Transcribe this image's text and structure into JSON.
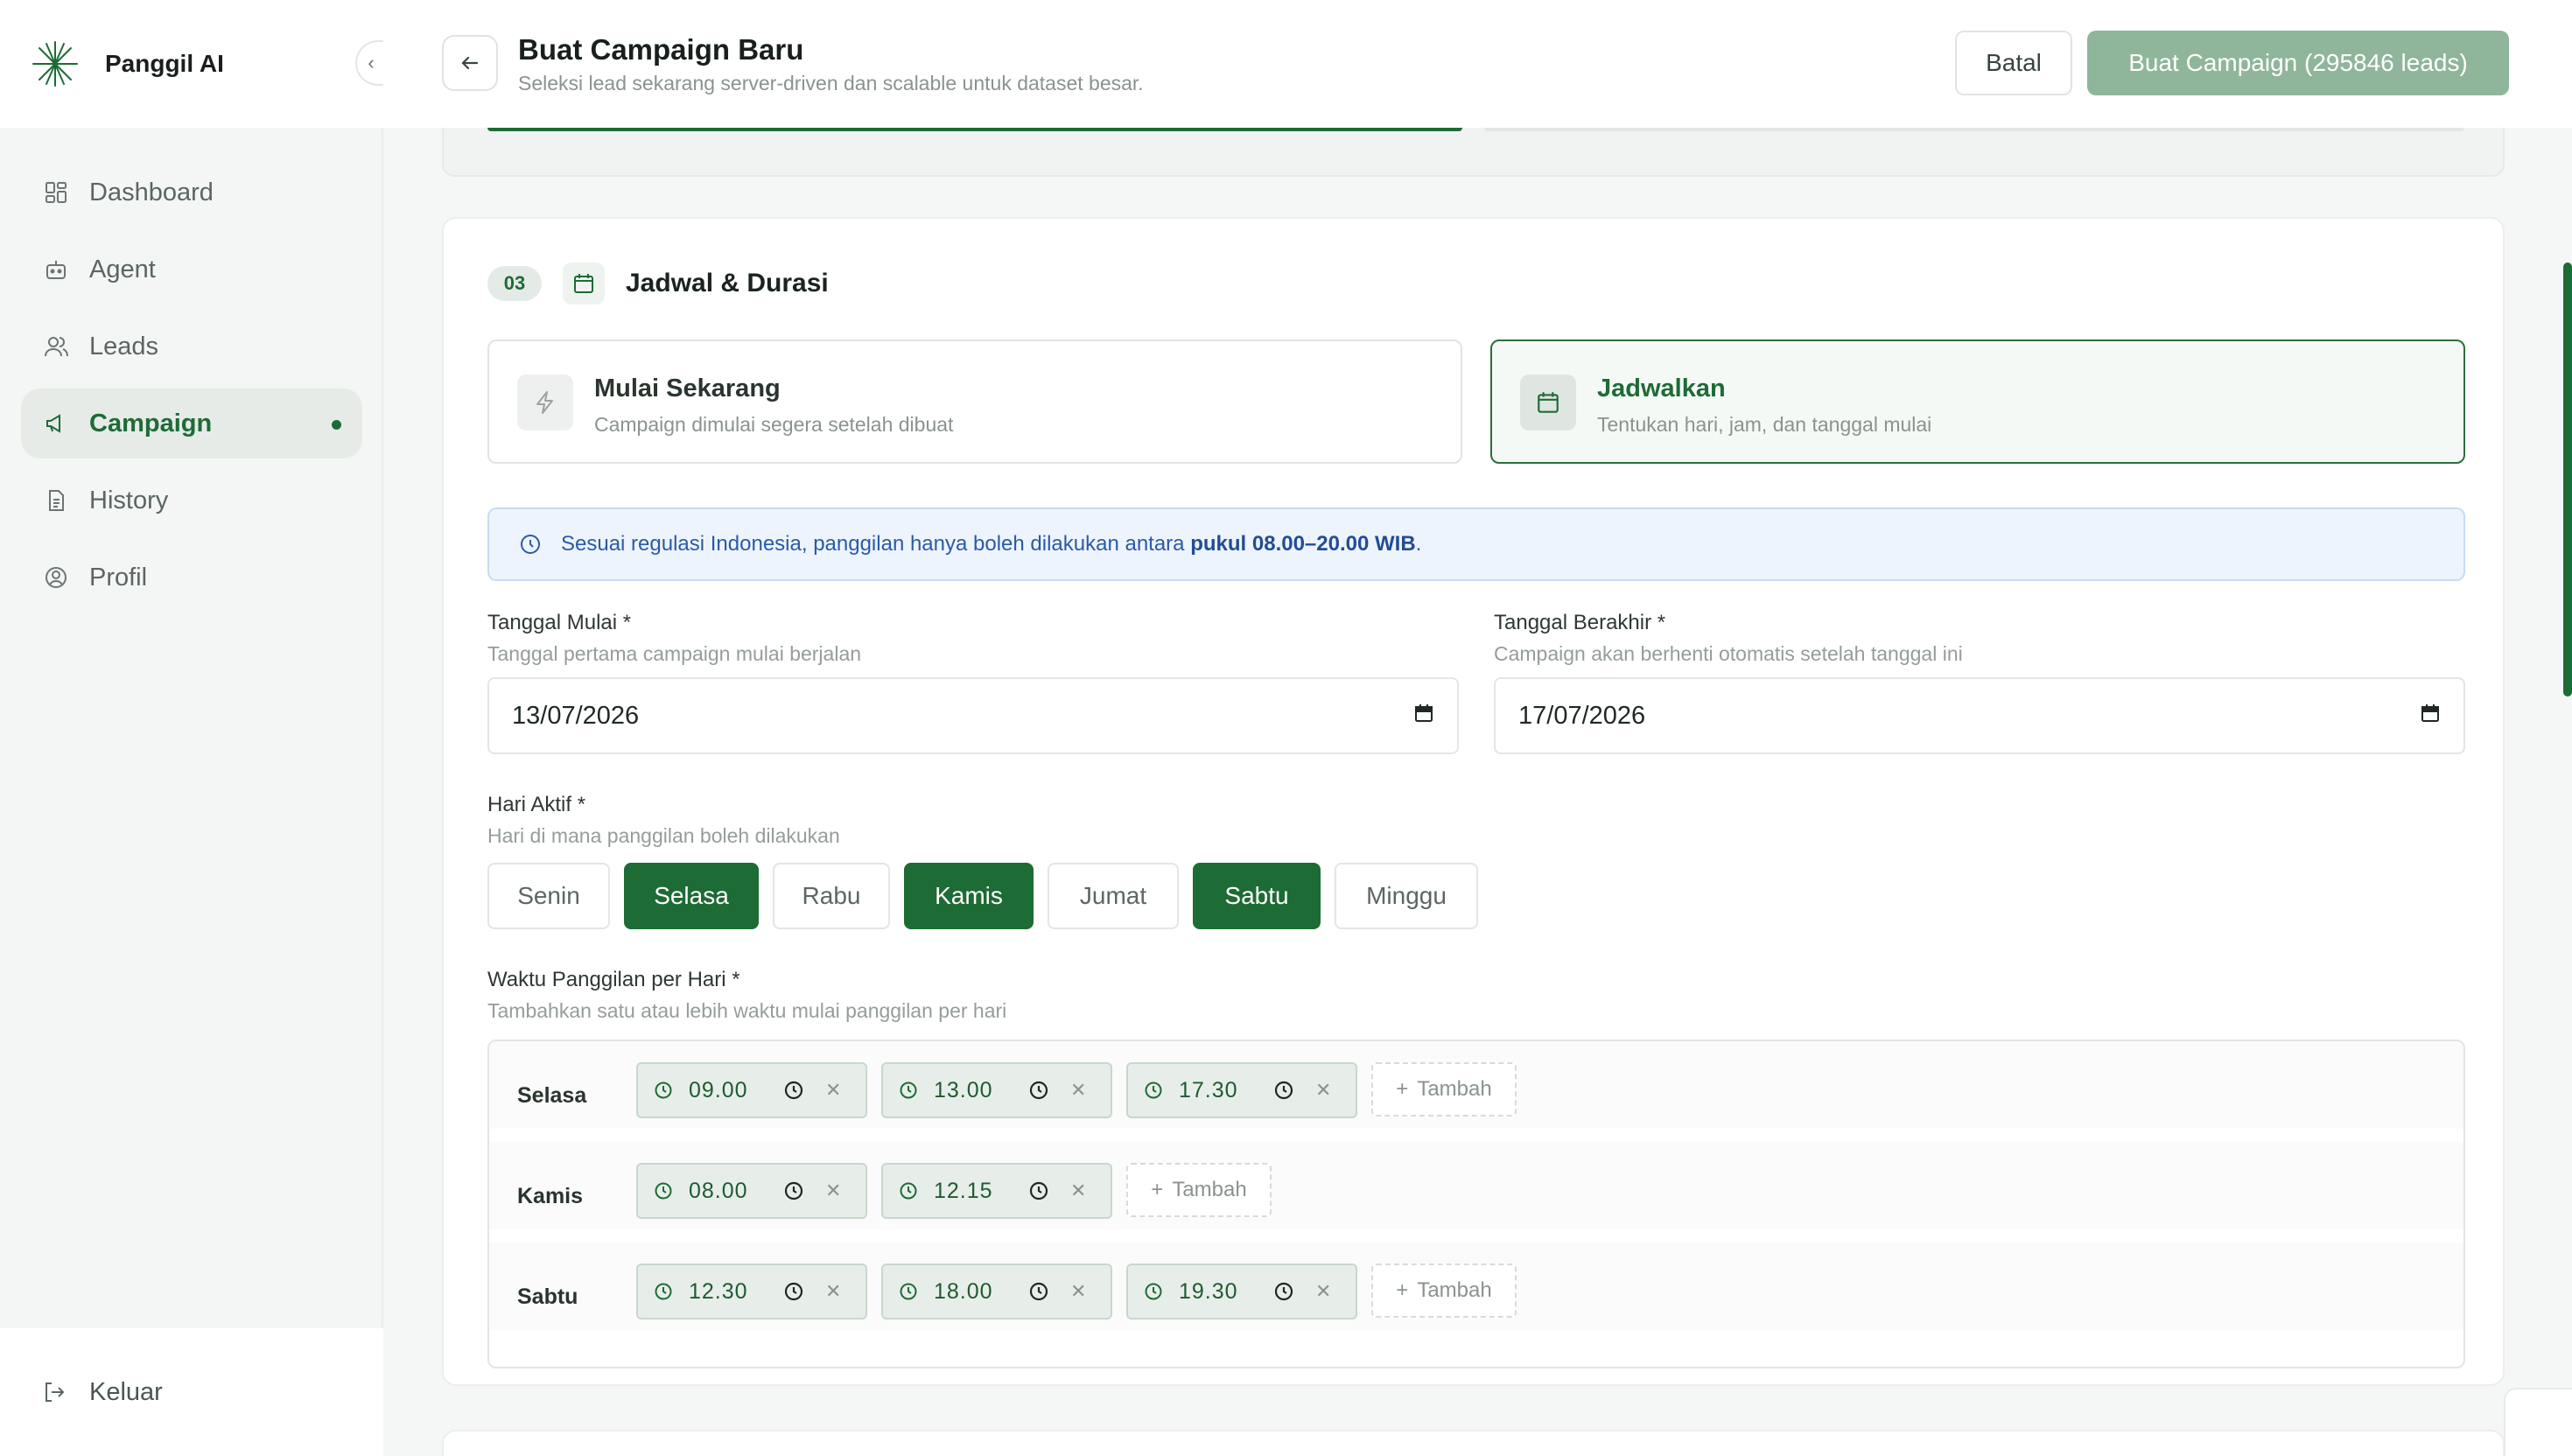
{
  "brand": {
    "name": "Panggil AI"
  },
  "sidebar": {
    "items": [
      {
        "label": "Dashboard",
        "icon": "dashboard-icon"
      },
      {
        "label": "Agent",
        "icon": "bot-icon"
      },
      {
        "label": "Leads",
        "icon": "users-icon"
      },
      {
        "label": "Campaign",
        "icon": "megaphone-icon",
        "active": true
      },
      {
        "label": "History",
        "icon": "document-icon"
      },
      {
        "label": "Profil",
        "icon": "user-circle-icon"
      }
    ],
    "logout_label": "Keluar"
  },
  "header": {
    "title": "Buat Campaign Baru",
    "subtitle": "Seleksi lead sekarang server-driven dan scalable untuk dataset besar.",
    "cancel_label": "Batal",
    "create_label": "Buat Campaign (295846 leads)"
  },
  "section": {
    "number": "03",
    "title": "Jadwal & Durasi",
    "options": [
      {
        "title": "Mulai Sekarang",
        "desc": "Campaign dimulai segera setelah dibuat",
        "selected": false
      },
      {
        "title": "Jadwalkan",
        "desc": "Tentukan hari, jam, dan tanggal mulai",
        "selected": true
      }
    ],
    "notice_prefix": "Sesuai regulasi Indonesia, panggilan hanya boleh dilakukan antara ",
    "notice_bold": "pukul 08.00–20.00 WIB",
    "notice_suffix": ".",
    "start_date": {
      "label": "Tanggal Mulai *",
      "help": "Tanggal pertama campaign mulai berjalan",
      "value": "13/07/2026"
    },
    "end_date": {
      "label": "Tanggal Berakhir *",
      "help": "Campaign akan berhenti otomatis setelah tanggal ini",
      "value": "17/07/2026"
    },
    "active_days": {
      "label": "Hari Aktif *",
      "help": "Hari di mana panggilan boleh dilakukan",
      "days": [
        {
          "label": "Senin",
          "on": false
        },
        {
          "label": "Selasa",
          "on": true
        },
        {
          "label": "Rabu",
          "on": false
        },
        {
          "label": "Kamis",
          "on": true
        },
        {
          "label": "Jumat",
          "on": false
        },
        {
          "label": "Sabtu",
          "on": true
        },
        {
          "label": "Minggu",
          "on": false
        }
      ]
    },
    "call_times": {
      "label": "Waktu Panggilan per Hari *",
      "help": "Tambahkan satu atau lebih waktu mulai panggilan per hari",
      "add_label": "Tambah",
      "rows": [
        {
          "day": "Selasa",
          "times": [
            "09.00",
            "13.00",
            "17.30"
          ]
        },
        {
          "day": "Kamis",
          "times": [
            "08.00",
            "12.15"
          ]
        },
        {
          "day": "Sabtu",
          "times": [
            "12.30",
            "18.00",
            "19.30"
          ]
        }
      ]
    }
  },
  "colors": {
    "accent": "#1d6b35",
    "accent_muted": "#8fb59a",
    "info": "#2a5aa8"
  }
}
